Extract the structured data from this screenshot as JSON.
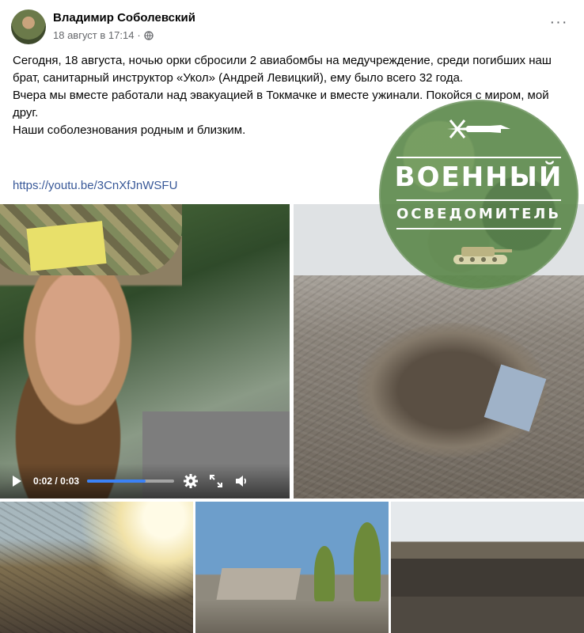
{
  "post": {
    "author": "Владимир Соболевский",
    "date": "18 август в 17:14",
    "separator": "·",
    "privacy_icon": "globe-icon",
    "more_label": "···",
    "text_lines": [
      "Сегодня, 18 августа, ночью орки сбросили 2 авиабомбы на медучреждение, среди погибших наш брат, санитарный инструктор «Укол» (Андрей Левицкий), ему было всего 32 года.",
      "Вчера мы вместе работали над эвакуацией в Токмачке и вместе ужинали. Покойся с миром, мой друг.",
      "Наши соболезнования родным и близким."
    ],
    "link": "https://youtu.be/3CnXfJnWSFU"
  },
  "watermark": {
    "title": "ВОЕННЫЙ",
    "subtitle": "ОСВЕДОМИТЕЛЬ"
  },
  "video": {
    "current_time": "0:02",
    "time_separator": "/",
    "duration": "0:03",
    "progress_fraction": 0.67,
    "icons": [
      "play-icon",
      "settings-icon",
      "fullscreen-icon",
      "volume-icon"
    ]
  },
  "colors": {
    "link": "#385898",
    "progress": "#3b82f6",
    "meta": "#65676b",
    "badge": "#5e8a4e"
  }
}
